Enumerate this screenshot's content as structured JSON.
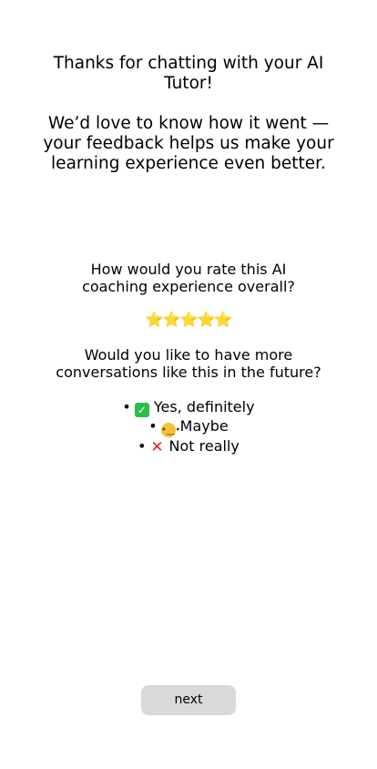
{
  "intro": {
    "thanks": "Thanks for chatting with your AI Tutor!",
    "feedback": "We’d love to know how it went — your feedback helps us make your learning experience even better."
  },
  "rating_question": {
    "line1": "How would you rate this AI",
    "line2": "coaching experience overall?"
  },
  "rating": {
    "stars": [
      "⭐",
      "⭐",
      "⭐",
      "⭐",
      "⭐"
    ],
    "star_color": "#f6c72a"
  },
  "future_question": {
    "line1": "Would you like to have more",
    "line2": "conversations like this in the future?"
  },
  "options": [
    {
      "icon": "check-mark-icon",
      "label": "Yes, definitely"
    },
    {
      "icon": "thinking-face-icon",
      "label": "Maybe"
    },
    {
      "icon": "cross-mark-icon",
      "label": "Not really"
    }
  ],
  "bullet": "•",
  "next_button": {
    "label": "next",
    "background": "#d9d9d9"
  }
}
